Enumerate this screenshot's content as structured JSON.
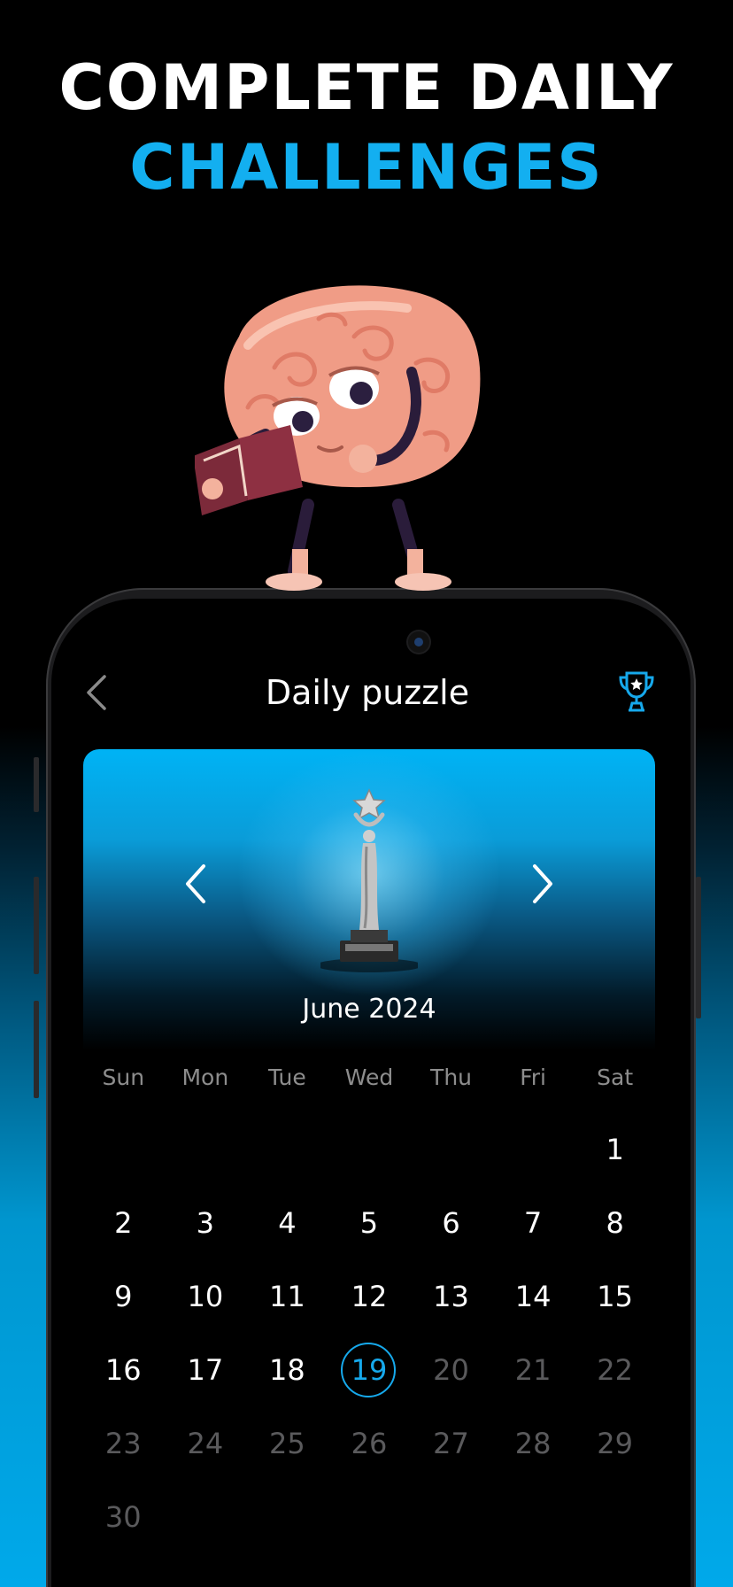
{
  "promo": {
    "line1": "COMPLETE DAILY",
    "line2": "CHALLENGES",
    "line2_color": "#13aff0"
  },
  "mascot": {
    "icon": "brain-reading-book-icon"
  },
  "header": {
    "title": "Daily puzzle",
    "back_icon": "chevron-left-icon",
    "trophy_icon": "trophy-icon",
    "accent": "#16a9ec"
  },
  "month_card": {
    "label": "June 2024",
    "prev_icon": "chevron-left-icon",
    "next_icon": "chevron-right-icon",
    "award_icon": "silver-statue-trophy-icon"
  },
  "calendar": {
    "weekdays": [
      "Sun",
      "Mon",
      "Tue",
      "Wed",
      "Thu",
      "Fri",
      "Sat"
    ],
    "weeks": [
      [
        {
          "label": "",
          "state": "empty"
        },
        {
          "label": "",
          "state": "empty"
        },
        {
          "label": "",
          "state": "empty"
        },
        {
          "label": "",
          "state": "empty"
        },
        {
          "label": "",
          "state": "empty"
        },
        {
          "label": "",
          "state": "empty"
        },
        {
          "label": "1",
          "state": "active"
        }
      ],
      [
        {
          "label": "2",
          "state": "active"
        },
        {
          "label": "3",
          "state": "active"
        },
        {
          "label": "4",
          "state": "active"
        },
        {
          "label": "5",
          "state": "active"
        },
        {
          "label": "6",
          "state": "active"
        },
        {
          "label": "7",
          "state": "active"
        },
        {
          "label": "8",
          "state": "active"
        }
      ],
      [
        {
          "label": "9",
          "state": "active"
        },
        {
          "label": "10",
          "state": "active"
        },
        {
          "label": "11",
          "state": "active"
        },
        {
          "label": "12",
          "state": "active"
        },
        {
          "label": "13",
          "state": "active"
        },
        {
          "label": "14",
          "state": "active"
        },
        {
          "label": "15",
          "state": "active"
        }
      ],
      [
        {
          "label": "16",
          "state": "active"
        },
        {
          "label": "17",
          "state": "active"
        },
        {
          "label": "18",
          "state": "active"
        },
        {
          "label": "19",
          "state": "today"
        },
        {
          "label": "20",
          "state": "future"
        },
        {
          "label": "21",
          "state": "future"
        },
        {
          "label": "22",
          "state": "future"
        }
      ],
      [
        {
          "label": "23",
          "state": "future"
        },
        {
          "label": "24",
          "state": "future"
        },
        {
          "label": "25",
          "state": "future"
        },
        {
          "label": "26",
          "state": "future"
        },
        {
          "label": "27",
          "state": "future"
        },
        {
          "label": "28",
          "state": "future"
        },
        {
          "label": "29",
          "state": "future"
        }
      ],
      [
        {
          "label": "30",
          "state": "future"
        },
        {
          "label": "",
          "state": "empty"
        },
        {
          "label": "",
          "state": "empty"
        },
        {
          "label": "",
          "state": "empty"
        },
        {
          "label": "",
          "state": "empty"
        },
        {
          "label": "",
          "state": "empty"
        },
        {
          "label": "",
          "state": "empty"
        }
      ]
    ]
  }
}
